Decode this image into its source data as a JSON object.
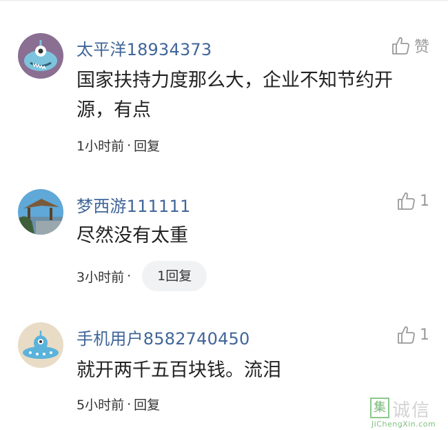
{
  "comments": [
    {
      "username": "太平洋18934373",
      "content": "国家扶持力度那么大，企业不知节约开源，有点",
      "time": "1小时前",
      "separator": "·",
      "reply_label": "回复",
      "like_label": "赞",
      "avatar_icon": "blue-monster-avatar"
    },
    {
      "username": "梦西游111111",
      "content": "尽然没有太重",
      "time": "3小时前",
      "separator": "·",
      "reply_label": "1回复",
      "like_label": "1",
      "avatar_icon": "beach-hut-photo-avatar"
    },
    {
      "username": "手机用户8582740450",
      "content": "就开两千五百块钱。流泪",
      "time": "5小时前",
      "separator": "·",
      "reply_label": "回复",
      "like_label": "1",
      "avatar_icon": "ufo-alien-avatar"
    }
  ],
  "watermark": {
    "icon_char": "集",
    "title": "诚信",
    "url": "JiChengXin.com"
  },
  "colors": {
    "username": "#406599",
    "content": "#222222",
    "meta": "#333333",
    "like": "#999999",
    "reply_pill_bg": "#f1f2f4"
  }
}
